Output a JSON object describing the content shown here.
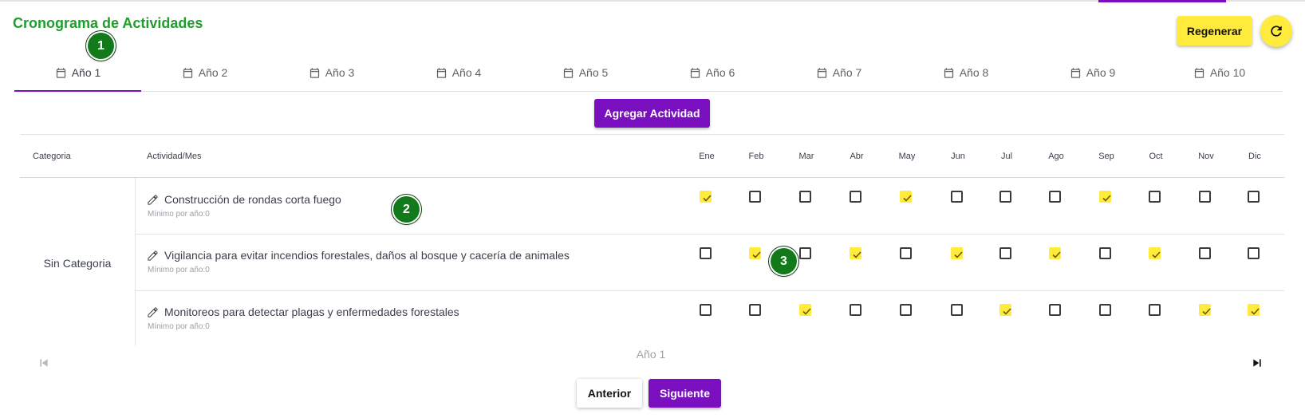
{
  "title": "Cronograma de Actividades",
  "markers": [
    "1",
    "2",
    "3"
  ],
  "header": {
    "regenerate_label": "Regenerar"
  },
  "tabs": [
    "Año 1",
    "Año 2",
    "Año 3",
    "Año 4",
    "Año 5",
    "Año 6",
    "Año 7",
    "Año 8",
    "Año 9",
    "Año 10"
  ],
  "active_tab": "Año 1",
  "add_activity_label": "Agregar Actividad",
  "table": {
    "col_category": "Categoria",
    "col_activity": "Actividad/Mes",
    "months": [
      "Ene",
      "Feb",
      "Mar",
      "Abr",
      "May",
      "Jun",
      "Jul",
      "Ago",
      "Sep",
      "Oct",
      "Nov",
      "Dic"
    ],
    "category": "Sin Categoria",
    "rows": [
      {
        "activity": "Construcción de rondas corta fuego",
        "minimum": "Mínimo por año:0",
        "checks": [
          true,
          false,
          false,
          false,
          true,
          false,
          false,
          false,
          true,
          false,
          false,
          false
        ]
      },
      {
        "activity": "Vigilancia para evitar incendios forestales, daños al bosque y cacería de animales",
        "minimum": "Mínimo por año:0",
        "checks": [
          false,
          true,
          false,
          true,
          false,
          true,
          false,
          true,
          false,
          true,
          false,
          false
        ]
      },
      {
        "activity": "Monitoreos para detectar plagas y enfermedades forestales",
        "minimum": "Mínimo por año:0",
        "checks": [
          false,
          false,
          true,
          false,
          false,
          false,
          true,
          false,
          false,
          false,
          true,
          true
        ]
      }
    ]
  },
  "pager": {
    "label": "Año 1"
  },
  "footer": {
    "prev_label": "Anterior",
    "next_label": "Siguiente"
  },
  "colors": {
    "accent": "#7a0fbf",
    "title": "#1e9e2a",
    "yellow": "#ffeb3b",
    "marker": "#137a1b"
  }
}
